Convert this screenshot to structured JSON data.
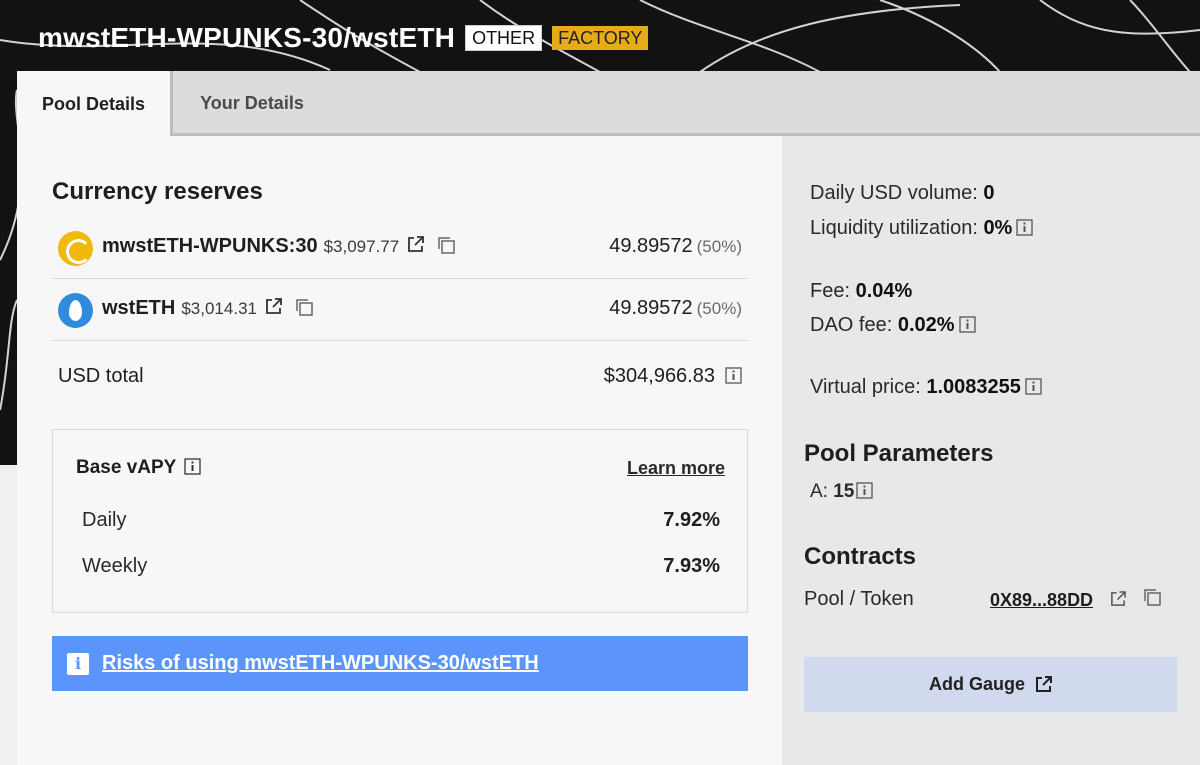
{
  "header": {
    "pool_title": "mwstETH-WPUNKS-30/wstETH",
    "badges": [
      "OTHER",
      "FACTORY"
    ],
    "badge_colors": {
      "other": "#ffffff",
      "factory": "#e7ab1a"
    }
  },
  "tabs": [
    {
      "label": "Pool Details",
      "active": true
    },
    {
      "label": "Your Details",
      "active": false
    }
  ],
  "reserves": {
    "title": "Currency reserves",
    "coins": [
      {
        "name": "mwstETH-WPUNKS:30",
        "price": "$3,097.77",
        "amount": "49.89572",
        "percent": "(50%)",
        "icon": "mwsteth-coin-icon"
      },
      {
        "name": "wstETH",
        "price": "$3,014.31",
        "amount": "49.89572",
        "percent": "(50%)",
        "icon": "wsteth-coin-icon"
      }
    ],
    "usd_total_label": "USD total",
    "usd_total_value": "$304,966.83"
  },
  "apy": {
    "title": "Base vAPY",
    "learn_more": "Learn more",
    "rows": [
      {
        "label": "Daily",
        "value": "7.92%"
      },
      {
        "label": "Weekly",
        "value": "7.93%"
      }
    ]
  },
  "risks": {
    "icon_char": "i",
    "link_text": "Risks of using mwstETH-WPUNKS-30/wstETH",
    "bar_color": "#5b95fb"
  },
  "stats": {
    "daily_volume_label": "Daily USD volume:",
    "daily_volume_value": "0",
    "liquidity_label": "Liquidity utilization:",
    "liquidity_value": "0%",
    "fee_label": "Fee:",
    "fee_value": "0.04%",
    "dao_fee_label": "DAO fee:",
    "dao_fee_value": "0.02%",
    "virtual_price_label": "Virtual price:",
    "virtual_price_value": "1.0083255"
  },
  "parameters": {
    "title": "Pool Parameters",
    "a_label": "A:",
    "a_value": "15"
  },
  "contracts": {
    "title": "Contracts",
    "label": "Pool / Token",
    "address": "0X89...88DD"
  },
  "add_gauge": {
    "label": "Add Gauge"
  }
}
